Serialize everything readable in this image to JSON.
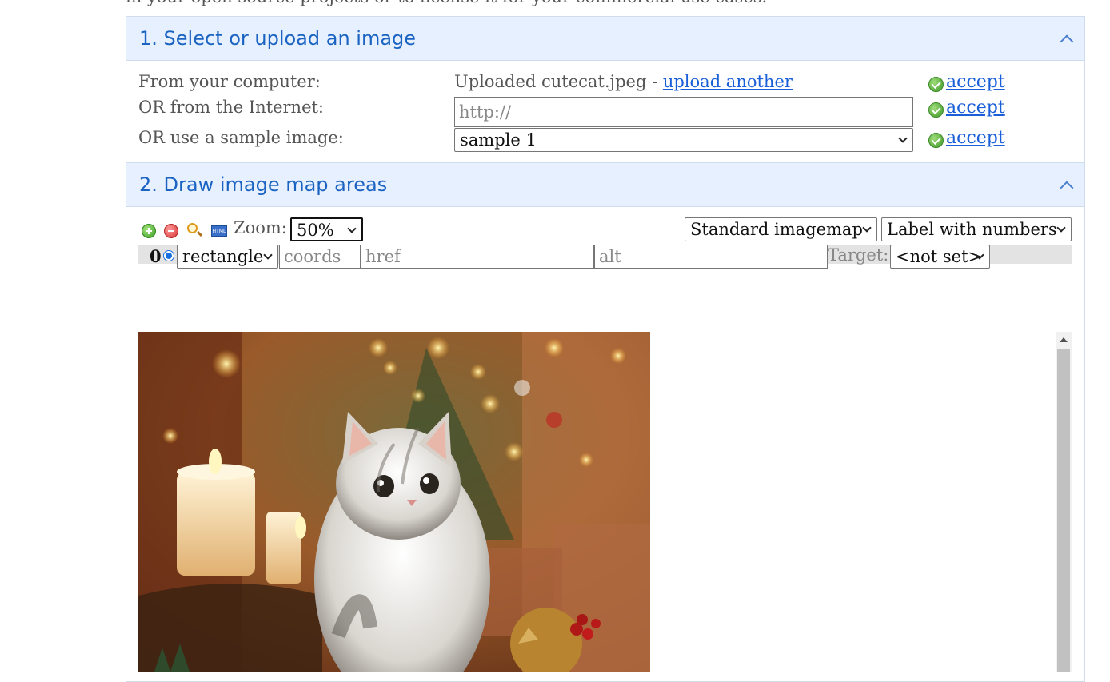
{
  "intro_text_clipped": "in your open source projects or to license it for your commercial use cases.",
  "section1": {
    "title": "1. Select or upload an image",
    "rows": {
      "computer_label": "From your computer:",
      "uploaded_text": "Uploaded cutecat.jpeg",
      "uploaded_sep": " - ",
      "upload_another": "upload another",
      "internet_label": "OR from the Internet:",
      "url_placeholder": "http://",
      "sample_label": "OR use a sample image:",
      "sample_selected": "sample 1"
    },
    "accept_label": "accept"
  },
  "section2": {
    "title": "2. Draw image map areas",
    "toolbar": {
      "zoom_label": "Zoom:",
      "zoom_value": "50%",
      "map_type": "Standard imagemap",
      "label_mode": "Label with numbers"
    },
    "area": {
      "index": "0",
      "shape": "rectangle",
      "coords_placeholder": "coords",
      "href_placeholder": "href",
      "alt_placeholder": "alt",
      "target_label": "Target:",
      "target_value": "<not set>"
    },
    "image_alt": "cutecat.jpeg"
  },
  "colors": {
    "header_bg": "#e7f0fe",
    "header_text": "#1a63c2",
    "link": "#1a5fd8"
  }
}
